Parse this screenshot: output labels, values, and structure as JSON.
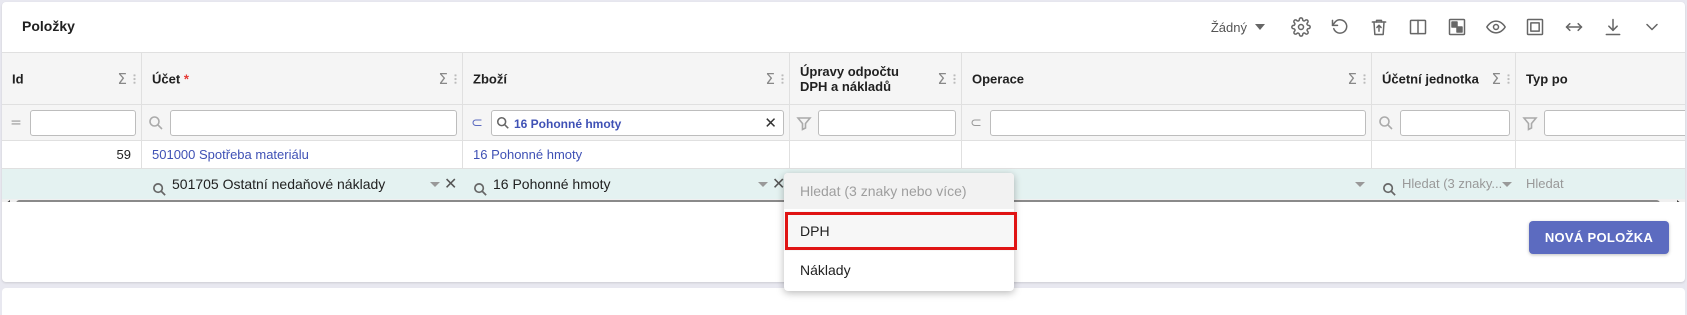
{
  "panel": {
    "title": "Položky"
  },
  "toolbar": {
    "filter_select": "Žádný",
    "buttons": [
      {
        "name": "settings-button",
        "icon": "gear-icon"
      },
      {
        "name": "undo-button",
        "icon": "undo-icon"
      },
      {
        "name": "delete-button",
        "icon": "trash-icon"
      },
      {
        "name": "split-view-button",
        "icon": "columns-icon"
      },
      {
        "name": "layout-button",
        "icon": "grid-icon"
      },
      {
        "name": "preview-button",
        "icon": "eye-icon"
      },
      {
        "name": "fit-view-button",
        "icon": "frame-icon"
      },
      {
        "name": "expand-width-button",
        "icon": "horizontal-arrows-icon"
      },
      {
        "name": "download-button",
        "icon": "download-icon"
      },
      {
        "name": "collapse-button",
        "icon": "chevron-down-icon"
      }
    ]
  },
  "columns": [
    {
      "key": "id",
      "label": "Id",
      "required": false,
      "sigma": "Σ"
    },
    {
      "key": "ucet",
      "label": "Účet",
      "required": true,
      "required_mark": "*",
      "sigma": "Σ"
    },
    {
      "key": "zbozi",
      "label": "Zboží",
      "required": false,
      "sigma": "Σ"
    },
    {
      "key": "upravy",
      "label": "Úpravy odpočtu DPH a nákladů",
      "required": false,
      "sigma": "Σ"
    },
    {
      "key": "operace",
      "label": "Operace",
      "required": false,
      "sigma": "Σ"
    },
    {
      "key": "ucetni_jednotka",
      "label": "Účetní jednotka",
      "required": false,
      "sigma": "Σ"
    },
    {
      "key": "typ",
      "label": "Typ po",
      "required": false
    }
  ],
  "filters": {
    "zbozi_value": "16 Pohonné hmoty",
    "id_icon": "=",
    "ucet_icon": "search-icon",
    "zbozi_icon": "subset-icon",
    "upravy_icon": "funnel-icon",
    "operace_icon": "subset-icon",
    "jednotka_icon": "search-icon",
    "typ_icon": "funnel-icon"
  },
  "rows": [
    {
      "id": "59",
      "ucet": "501000 Spotřeba materiálu",
      "zbozi": "16 Pohonné hmoty",
      "upravy": "",
      "operace": "",
      "ucetni_jednotka": ""
    }
  ],
  "edit_row": {
    "ucet": "501705 Ostatní nedaňové náklady",
    "zbozi": "16 Pohonné hmoty",
    "ucetni_jednotka_placeholder": "Hledat (3 znaky...",
    "typ_placeholder": "Hledat"
  },
  "dropdown": {
    "header": "Hledat (3 znaky nebo více)",
    "options": [
      "DPH",
      "Náklady"
    ],
    "highlighted_index": 0
  },
  "footer": {
    "new_item_label": "NOVÁ POLOŽKA"
  },
  "colors": {
    "accent": "#5c6bc0",
    "link": "#3f51b5",
    "edit_row_bg": "#e4f2f1",
    "highlight_box": "#e01414"
  }
}
